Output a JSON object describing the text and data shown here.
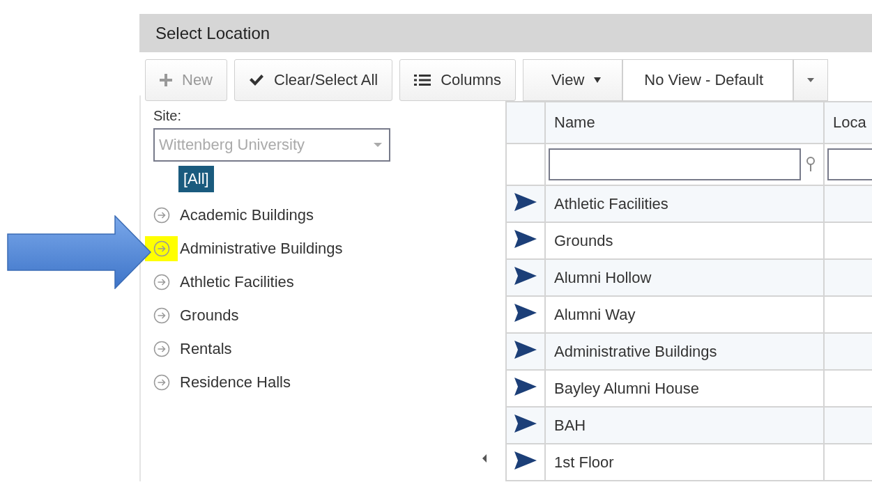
{
  "window": {
    "title": "Select Location"
  },
  "toolbar": [
    {
      "kind": "add",
      "label": "New",
      "disabled": true
    },
    {
      "kind": "check",
      "label": "Clear/Select All",
      "disabled": false
    },
    {
      "kind": "columns",
      "label": "Columns",
      "disabled": false
    },
    {
      "kind": "menu",
      "label": "View",
      "disabled": false
    }
  ],
  "view_select": {
    "value": "No View - Default"
  },
  "site": {
    "label": "Site:",
    "value": "Wittenberg University",
    "disabled": true
  },
  "tree": {
    "root": {
      "label": "[All]",
      "selected": true
    },
    "items": [
      {
        "label": "Academic Buildings",
        "highlighted": false
      },
      {
        "label": "Administrative Buildings",
        "highlighted": true
      },
      {
        "label": "Athletic Facilities",
        "highlighted": false
      },
      {
        "label": "Grounds",
        "highlighted": false
      },
      {
        "label": "Rentals",
        "highlighted": false
      },
      {
        "label": "Residence Halls",
        "highlighted": false
      }
    ]
  },
  "table": {
    "columns": [
      "Name",
      "Loca"
    ],
    "rows": [
      {
        "name": "Athletic Facilities"
      },
      {
        "name": "Grounds"
      },
      {
        "name": "Alumni Hollow"
      },
      {
        "name": "Alumni Way"
      },
      {
        "name": "Administrative Buildings"
      },
      {
        "name": "Bayley Alumni House"
      },
      {
        "name": "BAH"
      },
      {
        "name": "1st Floor"
      }
    ]
  },
  "annotation": {
    "kind": "arrow"
  }
}
